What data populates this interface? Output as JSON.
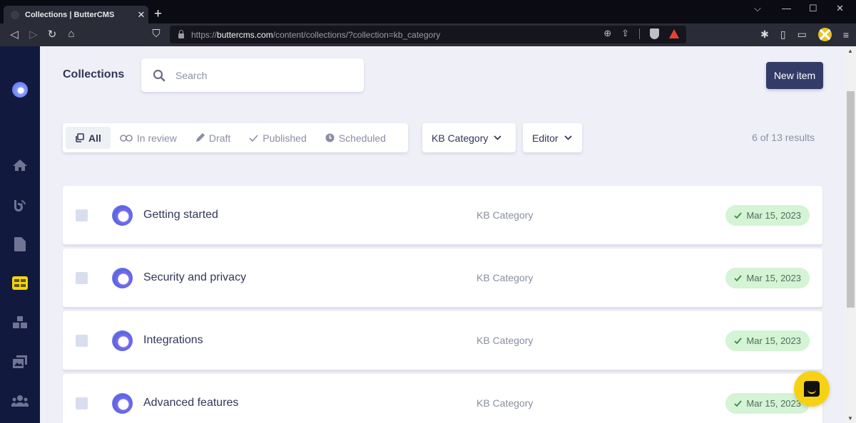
{
  "browser": {
    "tab_title": "Collections | ButterCMS",
    "tab_close": "✕",
    "new_tab": "+",
    "url_scheme": "https://",
    "url_host": "buttercms.com",
    "url_path": "/content/collections/?collection=kb_category",
    "window_controls": {
      "tabsearch": "⌵",
      "minimize": "—",
      "maximize": "☐",
      "close": "✕"
    }
  },
  "app": {
    "page_title": "Collections",
    "search_placeholder": "Search",
    "new_item_label": "New item",
    "status_tabs": [
      {
        "label": "All",
        "icon": "copy-icon",
        "active": true
      },
      {
        "label": "In review",
        "icon": "glasses-icon",
        "active": false
      },
      {
        "label": "Draft",
        "icon": "pencil-icon",
        "active": false
      },
      {
        "label": "Published",
        "icon": "check-icon",
        "active": false
      },
      {
        "label": "Scheduled",
        "icon": "clock-icon",
        "active": false
      }
    ],
    "collection_filter": "KB Category",
    "editor_filter": "Editor",
    "results_text": "6 of 13 results",
    "sidebar": [
      {
        "name": "home",
        "active": false
      },
      {
        "name": "blog",
        "active": false
      },
      {
        "name": "pages",
        "active": false
      },
      {
        "name": "collections",
        "active": true
      },
      {
        "name": "components",
        "active": false
      },
      {
        "name": "media",
        "active": false
      },
      {
        "name": "users",
        "active": false
      }
    ],
    "items": [
      {
        "title": "Getting started",
        "collection": "KB Category",
        "date": "Mar 15, 2023",
        "status": "published"
      },
      {
        "title": "Security and privacy",
        "collection": "KB Category",
        "date": "Mar 15, 2023",
        "status": "published"
      },
      {
        "title": "Integrations",
        "collection": "KB Category",
        "date": "Mar 15, 2023",
        "status": "published"
      },
      {
        "title": "Advanced features",
        "collection": "KB Category",
        "date": "Mar 15, 2023",
        "status": "published"
      }
    ],
    "colors": {
      "sidebar": "#12193f",
      "accent": "#f5d50a",
      "primary_button": "#323c67",
      "published_badge": "#d5f3d5"
    }
  }
}
